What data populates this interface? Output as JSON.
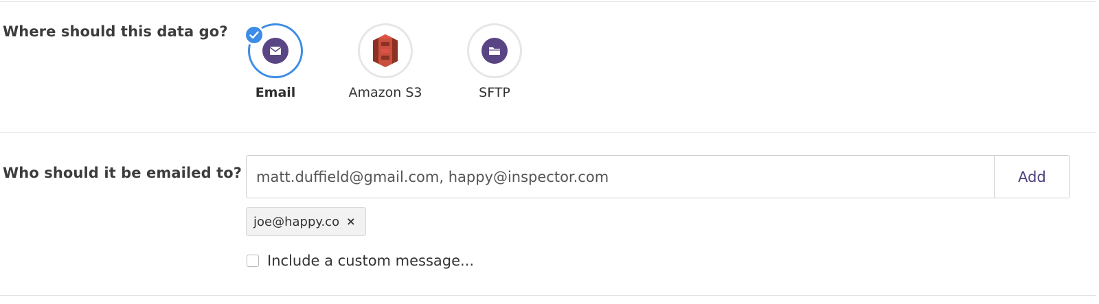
{
  "destination": {
    "label": "Where should this data go?",
    "options": [
      {
        "label": "Email",
        "icon": "envelope-icon",
        "selected": true
      },
      {
        "label": "Amazon S3",
        "icon": "amazon-s3-icon",
        "selected": false
      },
      {
        "label": "SFTP",
        "icon": "folder-icon",
        "selected": false
      }
    ]
  },
  "recipients": {
    "label": "Who should it be emailed to?",
    "input_value": "matt.duffield@gmail.com, happy@inspector.com",
    "add_label": "Add",
    "tags": [
      {
        "label": "joe@happy.co",
        "remove_glyph": "×"
      }
    ],
    "custom_message_label": "Include a custom message...",
    "custom_message_checked": false
  },
  "colors": {
    "accent": "#3d8de6",
    "brand_purple": "#5a4584",
    "s3_red": "#c7503e"
  }
}
